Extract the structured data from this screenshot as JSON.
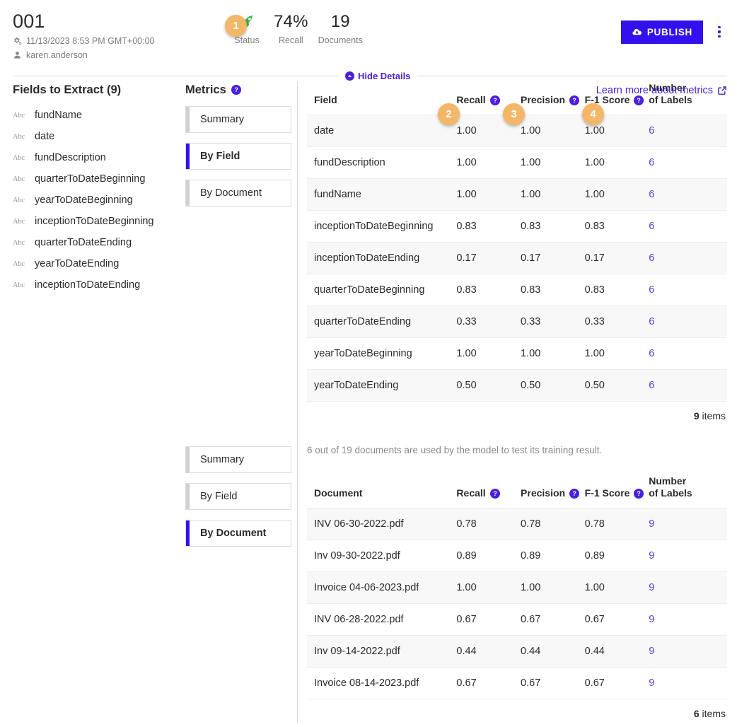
{
  "header": {
    "title": "001",
    "timestamp": "11/13/2023 8:53 PM GMT+00:00",
    "user": "karen.anderson",
    "settings_icon": "gears-icon",
    "user_icon": "person-icon",
    "status": {
      "badge_number": "1",
      "label": "Status",
      "icon": "rocket-icon",
      "icon_color": "#3cb34a"
    },
    "recall": {
      "value": "74%",
      "label": "Recall"
    },
    "documents": {
      "value": "19",
      "label": "Documents"
    },
    "publish_label": "PUBLISH",
    "publish_icon": "cloud-upload-icon",
    "publish_color": "#3311ee",
    "kebab_icon": "more-vertical-icon",
    "hide_details_label": "Hide Details",
    "hide_details_icon": "chevron-up-circle-icon"
  },
  "fields_panel": {
    "title": "Fields to Extract (9)",
    "field_icon": "abc-text-icon",
    "items": [
      "fundName",
      "date",
      "fundDescription",
      "quarterToDateBeginning",
      "yearToDateBeginning",
      "inceptionToDateBeginning",
      "quarterToDateEnding",
      "yearToDateEnding",
      "inceptionToDateEnding"
    ]
  },
  "metrics": {
    "title": "Metrics",
    "help_icon": "question-circle-icon",
    "learn_more_label": "Learn more about metrics",
    "learn_more_icon": "external-link-icon",
    "tabs_top": [
      {
        "label": "Summary",
        "active": false
      },
      {
        "label": "By Field",
        "active": true
      },
      {
        "label": "By Document",
        "active": false
      }
    ],
    "tabs_bottom": [
      {
        "label": "Summary",
        "active": false
      },
      {
        "label": "By Field",
        "active": false
      },
      {
        "label": "By Document",
        "active": true
      }
    ],
    "accent_color": "#3311ee",
    "badge_color": "#f3b767"
  },
  "by_field_table": {
    "badges": {
      "recall": "2",
      "precision": "3",
      "f1": "4"
    },
    "headers": {
      "name": "Field",
      "recall": "Recall",
      "precision": "Precision",
      "f1": "F-1 Score",
      "labels_line1": "Number",
      "labels_line2": "of Labels"
    },
    "rows": [
      {
        "name": "date",
        "recall": "1.00",
        "precision": "1.00",
        "f1": "1.00",
        "labels": "6"
      },
      {
        "name": "fundDescription",
        "recall": "1.00",
        "precision": "1.00",
        "f1": "1.00",
        "labels": "6"
      },
      {
        "name": "fundName",
        "recall": "1.00",
        "precision": "1.00",
        "f1": "1.00",
        "labels": "6"
      },
      {
        "name": "inceptionToDateBeginning",
        "recall": "0.83",
        "precision": "0.83",
        "f1": "0.83",
        "labels": "6"
      },
      {
        "name": "inceptionToDateEnding",
        "recall": "0.17",
        "precision": "0.17",
        "f1": "0.17",
        "labels": "6"
      },
      {
        "name": "quarterToDateBeginning",
        "recall": "0.83",
        "precision": "0.83",
        "f1": "0.83",
        "labels": "6"
      },
      {
        "name": "quarterToDateEnding",
        "recall": "0.33",
        "precision": "0.33",
        "f1": "0.33",
        "labels": "6"
      },
      {
        "name": "yearToDateBeginning",
        "recall": "1.00",
        "precision": "1.00",
        "f1": "1.00",
        "labels": "6"
      },
      {
        "name": "yearToDateEnding",
        "recall": "0.50",
        "precision": "0.50",
        "f1": "0.50",
        "labels": "6"
      }
    ],
    "items_count": "9",
    "items_word": "items"
  },
  "by_document_table": {
    "note": "6 out of 19 documents are used by the model to test its training result.",
    "headers": {
      "name": "Document",
      "recall": "Recall",
      "precision": "Precision",
      "f1": "F-1 Score",
      "labels_line1": "Number",
      "labels_line2": "of Labels"
    },
    "rows": [
      {
        "name": "INV 06-30-2022.pdf",
        "recall": "0.78",
        "precision": "0.78",
        "f1": "0.78",
        "labels": "9"
      },
      {
        "name": "Inv 09-30-2022.pdf",
        "recall": "0.89",
        "precision": "0.89",
        "f1": "0.89",
        "labels": "9"
      },
      {
        "name": "Invoice 04-06-2023.pdf",
        "recall": "1.00",
        "precision": "1.00",
        "f1": "1.00",
        "labels": "9"
      },
      {
        "name": "INV 06-28-2022.pdf",
        "recall": "0.67",
        "precision": "0.67",
        "f1": "0.67",
        "labels": "9"
      },
      {
        "name": "Inv 09-14-2022.pdf",
        "recall": "0.44",
        "precision": "0.44",
        "f1": "0.44",
        "labels": "9"
      },
      {
        "name": "Invoice 08-14-2023.pdf",
        "recall": "0.67",
        "precision": "0.67",
        "f1": "0.67",
        "labels": "9"
      }
    ],
    "items_count": "6",
    "items_word": "items"
  }
}
